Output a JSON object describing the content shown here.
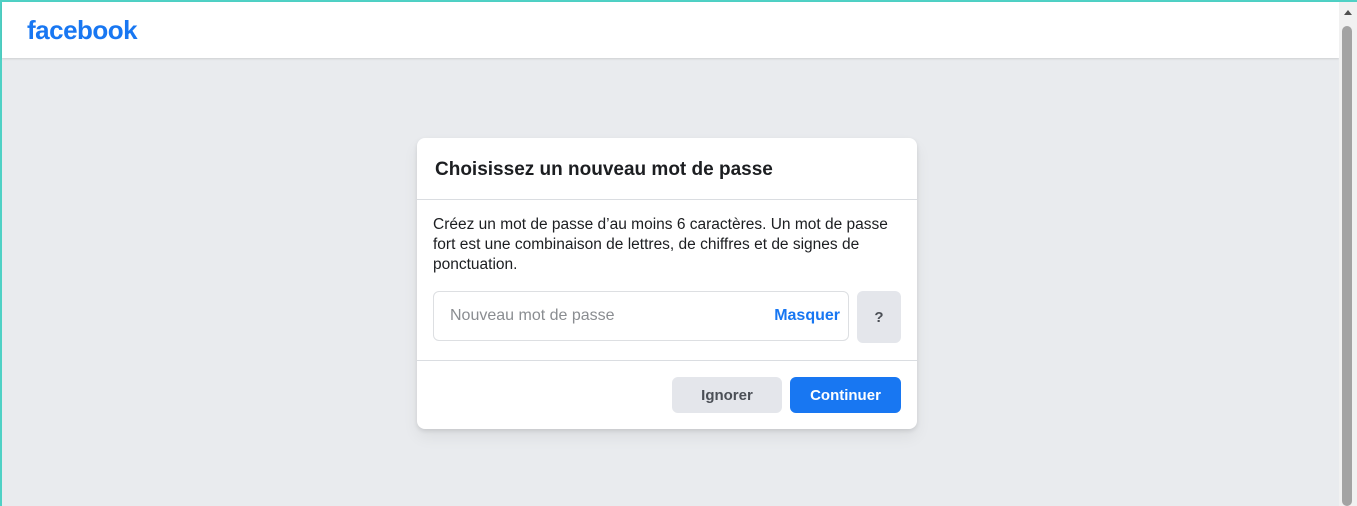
{
  "header": {
    "logo_text": "facebook"
  },
  "dialog": {
    "title": "Choisissez un nouveau mot de passe",
    "description": "Créez un mot de passe d’au moins 6 caractères. Un mot de passe fort est une combinaison de lettres, de chiffres et de signes de ponctuation.",
    "password_field": {
      "value": "",
      "placeholder": "Nouveau mot de passe",
      "toggle_label": "Masquer"
    },
    "help_label": "?",
    "buttons": {
      "ignore_label": "Ignorer",
      "continue_label": "Continuer"
    }
  },
  "colors": {
    "brand": "#1877f2",
    "background": "#e9ebee",
    "secondary_button": "#e4e6eb"
  },
  "icons": {
    "scroll_up": "chevron-up-icon"
  }
}
